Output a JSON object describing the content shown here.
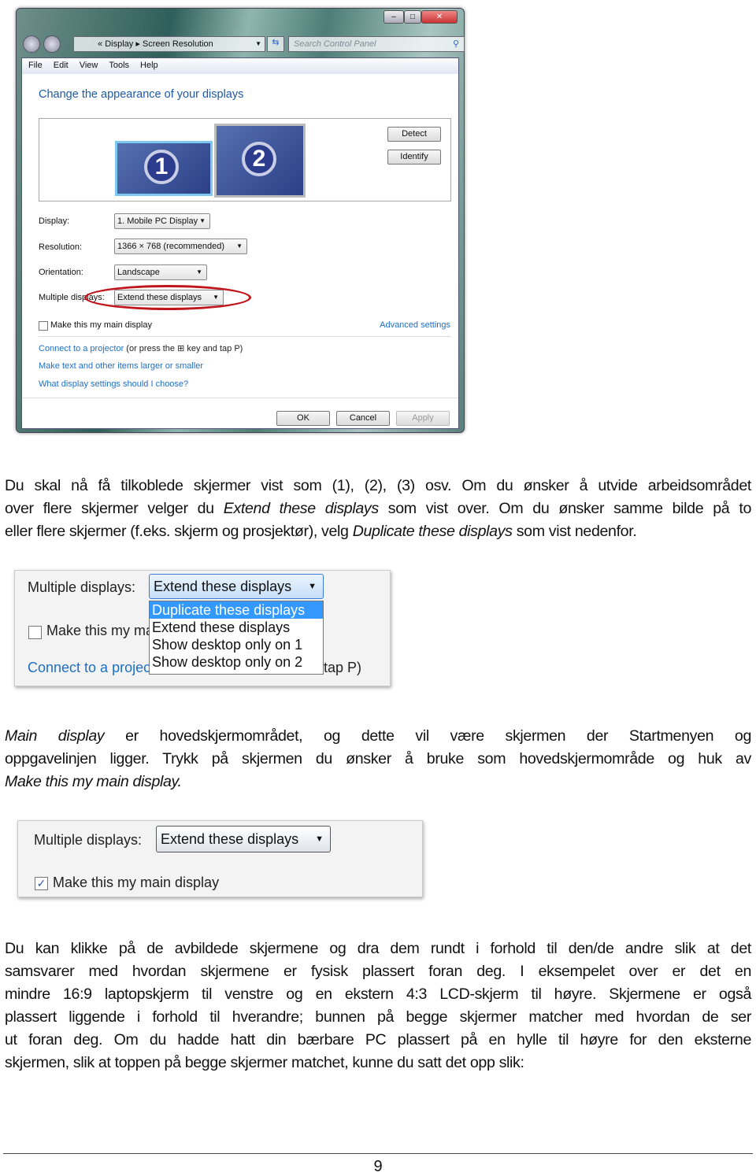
{
  "window": {
    "breadcrumb": [
      "Display",
      "Screen Resolution"
    ],
    "search_placeholder": "Search Control Panel",
    "menu": [
      "File",
      "Edit",
      "View",
      "Tools",
      "Help"
    ],
    "heading": "Change the appearance of your displays",
    "monitors": [
      "1",
      "2"
    ],
    "detect": "Detect",
    "identify": "Identify",
    "fields": [
      {
        "label": "Display:",
        "value": "1. Mobile PC Display"
      },
      {
        "label": "Resolution:",
        "value": "1366 × 768 (recommended)"
      },
      {
        "label": "Orientation:",
        "value": "Landscape"
      },
      {
        "label": "Multiple displays:",
        "value": "Extend these displays"
      }
    ],
    "main_display": "Make this my main display",
    "advanced": "Advanced settings",
    "projector_link": "Connect to a projector",
    "projector_rest": "(or press the",
    "projector_tail": "key and tap P)",
    "text_size_link": "Make text and other items larger or smaller",
    "help_link": "What display settings should I choose?",
    "ok": "OK",
    "cancel": "Cancel",
    "apply": "Apply",
    "highlight_color": "#c0151b"
  },
  "paragraphs": [
    [
      [
        [
          "Du skal nå få tilkoblede skjermer vist som (1), (2), (3) osv. Om du ønsker å utvide arbeidsområdet",
          0
        ]
      ],
      [
        [
          "over flere skjermer velger du ",
          0
        ],
        [
          "Extend these displays",
          1
        ],
        [
          " som vist over. Om du ønsker samme bilde på to",
          0
        ]
      ],
      [
        [
          "eller flere skjermer (f.eks. skjerm og prosjektør), velg ",
          0
        ],
        [
          "Duplicate these displays",
          1
        ],
        [
          " som vist nedenfor.",
          0
        ]
      ]
    ],
    [
      [
        [
          "Main display",
          1
        ],
        [
          " er hovedskjermområdet, og dette vil være skjermen der Startmenyen og",
          0
        ]
      ],
      [
        [
          "oppgavelinjen ligger. Trykk på skjermen du ønsker å bruke som hovedskjermområde og huk av",
          0
        ]
      ],
      [
        [
          "Make this my main display.",
          1
        ]
      ]
    ],
    [
      [
        [
          "Du kan klikke på de avbildede skjermene og dra dem rundt i forhold til den/de andre slik at det",
          0
        ]
      ],
      [
        [
          "samsvarer med hvordan skjermene er fysisk plassert foran deg. I eksempelet over er det en",
          0
        ]
      ],
      [
        [
          "mindre 16:9 laptopskjerm til venstre og en ekstern 4:3 LCD-skjerm til høyre. Skjermene er også",
          0
        ]
      ],
      [
        [
          "plassert liggende i forhold til hverandre; bunnen på begge skjermer matcher med hvordan de ser",
          0
        ]
      ],
      [
        [
          "ut foran deg. Om du hadde hatt din bærbare PC plassert på en hylle til høyre for den eksterne",
          0
        ]
      ],
      [
        [
          "skjermen, slik at toppen på begge skjermer matchet, kunne du satt det opp slik:",
          0
        ]
      ]
    ]
  ],
  "snippet2": {
    "label": "Multiple displays:",
    "value": "Extend these displays",
    "options": [
      "Duplicate these displays",
      "Extend these displays",
      "Show desktop only on 1",
      "Show desktop only on 2"
    ],
    "checkbox_partial": "Make this my ma",
    "link_partial": "Connect to a projec",
    "tail_partial": "tap P)"
  },
  "snippet3": {
    "label": "Multiple displays:",
    "value": "Extend these displays",
    "checkbox": "Make this my main display",
    "checked": true
  },
  "page_number": "9"
}
